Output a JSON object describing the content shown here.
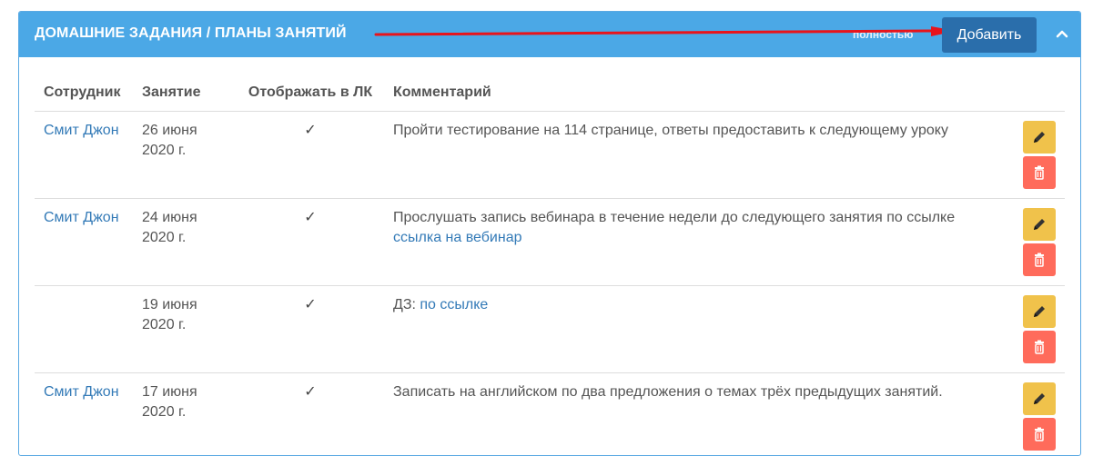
{
  "header": {
    "title": "ДОМАШНИЕ ЗАДАНИЯ / ПЛАНЫ ЗАНЯТИЙ",
    "full_link": "полностью",
    "add_label": "Добавить",
    "accent": "#4ba8e6"
  },
  "table": {
    "columns": {
      "employee": "Сотрудник",
      "lesson": "Занятие",
      "show_in_account": "Отображать в ЛК",
      "comment": "Комментарий"
    },
    "rows": [
      {
        "employee": "Смит Джон",
        "date_line1": "26 июня",
        "date_line2": "2020 г.",
        "check": "✓",
        "comment_text": "Пройти тестирование на 114 странице, ответы предоставить к следующему уроку",
        "comment_link": ""
      },
      {
        "employee": "Смит Джон",
        "date_line1": "24 июня",
        "date_line2": "2020 г.",
        "check": "✓",
        "comment_text": "Прослушать запись вебинара в течение недели до следующего занятия по ссылке ",
        "comment_link": "ссылка на вебинар"
      },
      {
        "employee": "",
        "date_line1": "19 июня",
        "date_line2": "2020 г.",
        "check": "✓",
        "comment_text": "ДЗ: ",
        "comment_link": "по ссылке"
      },
      {
        "employee": "Смит Джон",
        "date_line1": "17 июня",
        "date_line2": "2020 г.",
        "check": "✓",
        "comment_text": "Записать на английском по два предложения о темах трёх предыдущих занятий.",
        "comment_link": ""
      }
    ]
  },
  "icons": {
    "edit": "pencil-icon",
    "delete": "trash-icon",
    "collapse": "chevron-up-icon"
  },
  "colors": {
    "edit_button": "#f0c24b",
    "delete_button": "#ff6b5b",
    "add_button": "#2a6eab",
    "link": "#337ab7",
    "annotation_arrow": "#e8141b"
  }
}
